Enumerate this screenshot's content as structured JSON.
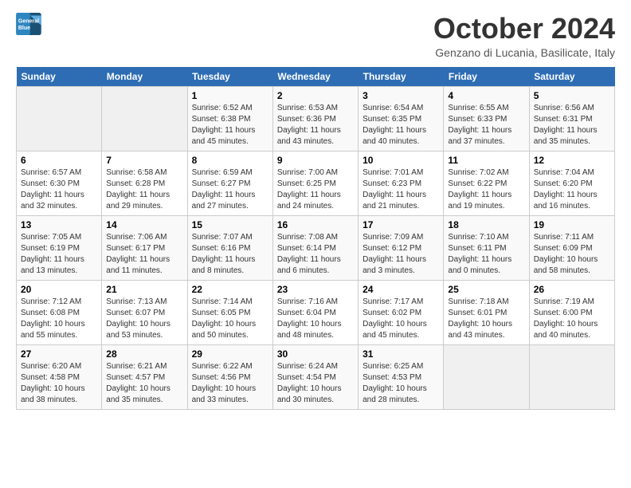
{
  "header": {
    "logo_line1": "General",
    "logo_line2": "Blue",
    "month": "October 2024",
    "location": "Genzano di Lucania, Basilicate, Italy"
  },
  "days_of_week": [
    "Sunday",
    "Monday",
    "Tuesday",
    "Wednesday",
    "Thursday",
    "Friday",
    "Saturday"
  ],
  "weeks": [
    [
      {
        "day": "",
        "info": ""
      },
      {
        "day": "",
        "info": ""
      },
      {
        "day": "1",
        "info": "Sunrise: 6:52 AM\nSunset: 6:38 PM\nDaylight: 11 hours\nand 45 minutes."
      },
      {
        "day": "2",
        "info": "Sunrise: 6:53 AM\nSunset: 6:36 PM\nDaylight: 11 hours\nand 43 minutes."
      },
      {
        "day": "3",
        "info": "Sunrise: 6:54 AM\nSunset: 6:35 PM\nDaylight: 11 hours\nand 40 minutes."
      },
      {
        "day": "4",
        "info": "Sunrise: 6:55 AM\nSunset: 6:33 PM\nDaylight: 11 hours\nand 37 minutes."
      },
      {
        "day": "5",
        "info": "Sunrise: 6:56 AM\nSunset: 6:31 PM\nDaylight: 11 hours\nand 35 minutes."
      }
    ],
    [
      {
        "day": "6",
        "info": "Sunrise: 6:57 AM\nSunset: 6:30 PM\nDaylight: 11 hours\nand 32 minutes."
      },
      {
        "day": "7",
        "info": "Sunrise: 6:58 AM\nSunset: 6:28 PM\nDaylight: 11 hours\nand 29 minutes."
      },
      {
        "day": "8",
        "info": "Sunrise: 6:59 AM\nSunset: 6:27 PM\nDaylight: 11 hours\nand 27 minutes."
      },
      {
        "day": "9",
        "info": "Sunrise: 7:00 AM\nSunset: 6:25 PM\nDaylight: 11 hours\nand 24 minutes."
      },
      {
        "day": "10",
        "info": "Sunrise: 7:01 AM\nSunset: 6:23 PM\nDaylight: 11 hours\nand 21 minutes."
      },
      {
        "day": "11",
        "info": "Sunrise: 7:02 AM\nSunset: 6:22 PM\nDaylight: 11 hours\nand 19 minutes."
      },
      {
        "day": "12",
        "info": "Sunrise: 7:04 AM\nSunset: 6:20 PM\nDaylight: 11 hours\nand 16 minutes."
      }
    ],
    [
      {
        "day": "13",
        "info": "Sunrise: 7:05 AM\nSunset: 6:19 PM\nDaylight: 11 hours\nand 13 minutes."
      },
      {
        "day": "14",
        "info": "Sunrise: 7:06 AM\nSunset: 6:17 PM\nDaylight: 11 hours\nand 11 minutes."
      },
      {
        "day": "15",
        "info": "Sunrise: 7:07 AM\nSunset: 6:16 PM\nDaylight: 11 hours\nand 8 minutes."
      },
      {
        "day": "16",
        "info": "Sunrise: 7:08 AM\nSunset: 6:14 PM\nDaylight: 11 hours\nand 6 minutes."
      },
      {
        "day": "17",
        "info": "Sunrise: 7:09 AM\nSunset: 6:12 PM\nDaylight: 11 hours\nand 3 minutes."
      },
      {
        "day": "18",
        "info": "Sunrise: 7:10 AM\nSunset: 6:11 PM\nDaylight: 11 hours\nand 0 minutes."
      },
      {
        "day": "19",
        "info": "Sunrise: 7:11 AM\nSunset: 6:09 PM\nDaylight: 10 hours\nand 58 minutes."
      }
    ],
    [
      {
        "day": "20",
        "info": "Sunrise: 7:12 AM\nSunset: 6:08 PM\nDaylight: 10 hours\nand 55 minutes."
      },
      {
        "day": "21",
        "info": "Sunrise: 7:13 AM\nSunset: 6:07 PM\nDaylight: 10 hours\nand 53 minutes."
      },
      {
        "day": "22",
        "info": "Sunrise: 7:14 AM\nSunset: 6:05 PM\nDaylight: 10 hours\nand 50 minutes."
      },
      {
        "day": "23",
        "info": "Sunrise: 7:16 AM\nSunset: 6:04 PM\nDaylight: 10 hours\nand 48 minutes."
      },
      {
        "day": "24",
        "info": "Sunrise: 7:17 AM\nSunset: 6:02 PM\nDaylight: 10 hours\nand 45 minutes."
      },
      {
        "day": "25",
        "info": "Sunrise: 7:18 AM\nSunset: 6:01 PM\nDaylight: 10 hours\nand 43 minutes."
      },
      {
        "day": "26",
        "info": "Sunrise: 7:19 AM\nSunset: 6:00 PM\nDaylight: 10 hours\nand 40 minutes."
      }
    ],
    [
      {
        "day": "27",
        "info": "Sunrise: 6:20 AM\nSunset: 4:58 PM\nDaylight: 10 hours\nand 38 minutes."
      },
      {
        "day": "28",
        "info": "Sunrise: 6:21 AM\nSunset: 4:57 PM\nDaylight: 10 hours\nand 35 minutes."
      },
      {
        "day": "29",
        "info": "Sunrise: 6:22 AM\nSunset: 4:56 PM\nDaylight: 10 hours\nand 33 minutes."
      },
      {
        "day": "30",
        "info": "Sunrise: 6:24 AM\nSunset: 4:54 PM\nDaylight: 10 hours\nand 30 minutes."
      },
      {
        "day": "31",
        "info": "Sunrise: 6:25 AM\nSunset: 4:53 PM\nDaylight: 10 hours\nand 28 minutes."
      },
      {
        "day": "",
        "info": ""
      },
      {
        "day": "",
        "info": ""
      }
    ]
  ]
}
